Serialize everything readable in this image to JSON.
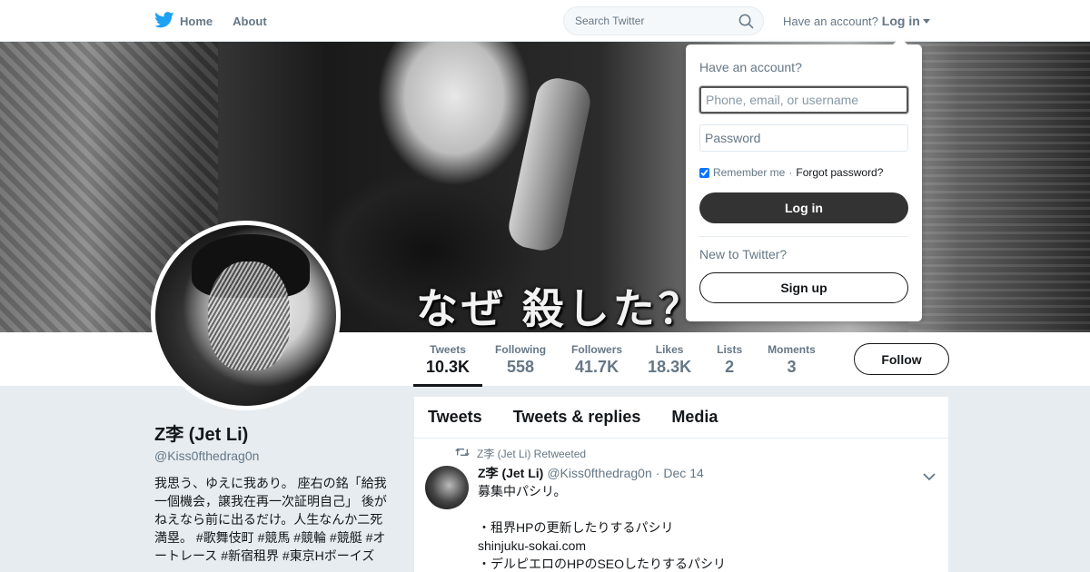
{
  "nav": {
    "home_label": "Home",
    "about_label": "About",
    "search_placeholder": "Search Twitter",
    "have_account": "Have an account?",
    "login_label": "Log in"
  },
  "banner": {
    "caption": "なぜ 殺した？"
  },
  "profile": {
    "display_name": "Z李 (Jet Li)",
    "handle": "@Kiss0fthedrag0n",
    "bio": "我思う、ゆえに我あり。 座右の銘「給我一個機会，譲我在再一次証明自己」 後がねえなら前に出るだけ。人生なんか二死満塁。 #歌舞伎町 #競馬 #競輪 #競艇 #オートレース #新宿租界 #東京Hボーイズ"
  },
  "stats": [
    {
      "label": "Tweets",
      "value": "10.3K"
    },
    {
      "label": "Following",
      "value": "558"
    },
    {
      "label": "Followers",
      "value": "41.7K"
    },
    {
      "label": "Likes",
      "value": "18.3K"
    },
    {
      "label": "Lists",
      "value": "2"
    },
    {
      "label": "Moments",
      "value": "3"
    }
  ],
  "follow_label": "Follow",
  "timeline": {
    "tabs": [
      "Tweets",
      "Tweets & replies",
      "Media"
    ],
    "tweet": {
      "retweet_context": "Z李 (Jet Li) Retweeted",
      "name": "Z李 (Jet Li)",
      "handle": "@Kiss0fthedrag0n",
      "dot": "·",
      "date": "Dec 14",
      "lines": [
        "募集中パシリ。",
        "",
        "・租界HPの更新したりするパシリ",
        "shinjuku-sokai.com",
        "・デルピエロのHPのSEOしたりするパシリ"
      ]
    }
  },
  "login_dropdown": {
    "title": "Have an account?",
    "username_placeholder": "Phone, email, or username",
    "password_placeholder": "Password",
    "remember_label": "Remember me",
    "separator": "·",
    "forgot_label": "Forgot password?",
    "login_button": "Log in",
    "new_label": "New to Twitter?",
    "signup_button": "Sign up"
  },
  "colors": {
    "brand_blue": "#1da1f2",
    "text_dark": "#14171a",
    "text_gray": "#657786",
    "background": "#e6ecf0"
  },
  "icons": [
    "twitter-bird-icon",
    "search-icon",
    "retweet-icon",
    "chevron-down-icon"
  ]
}
